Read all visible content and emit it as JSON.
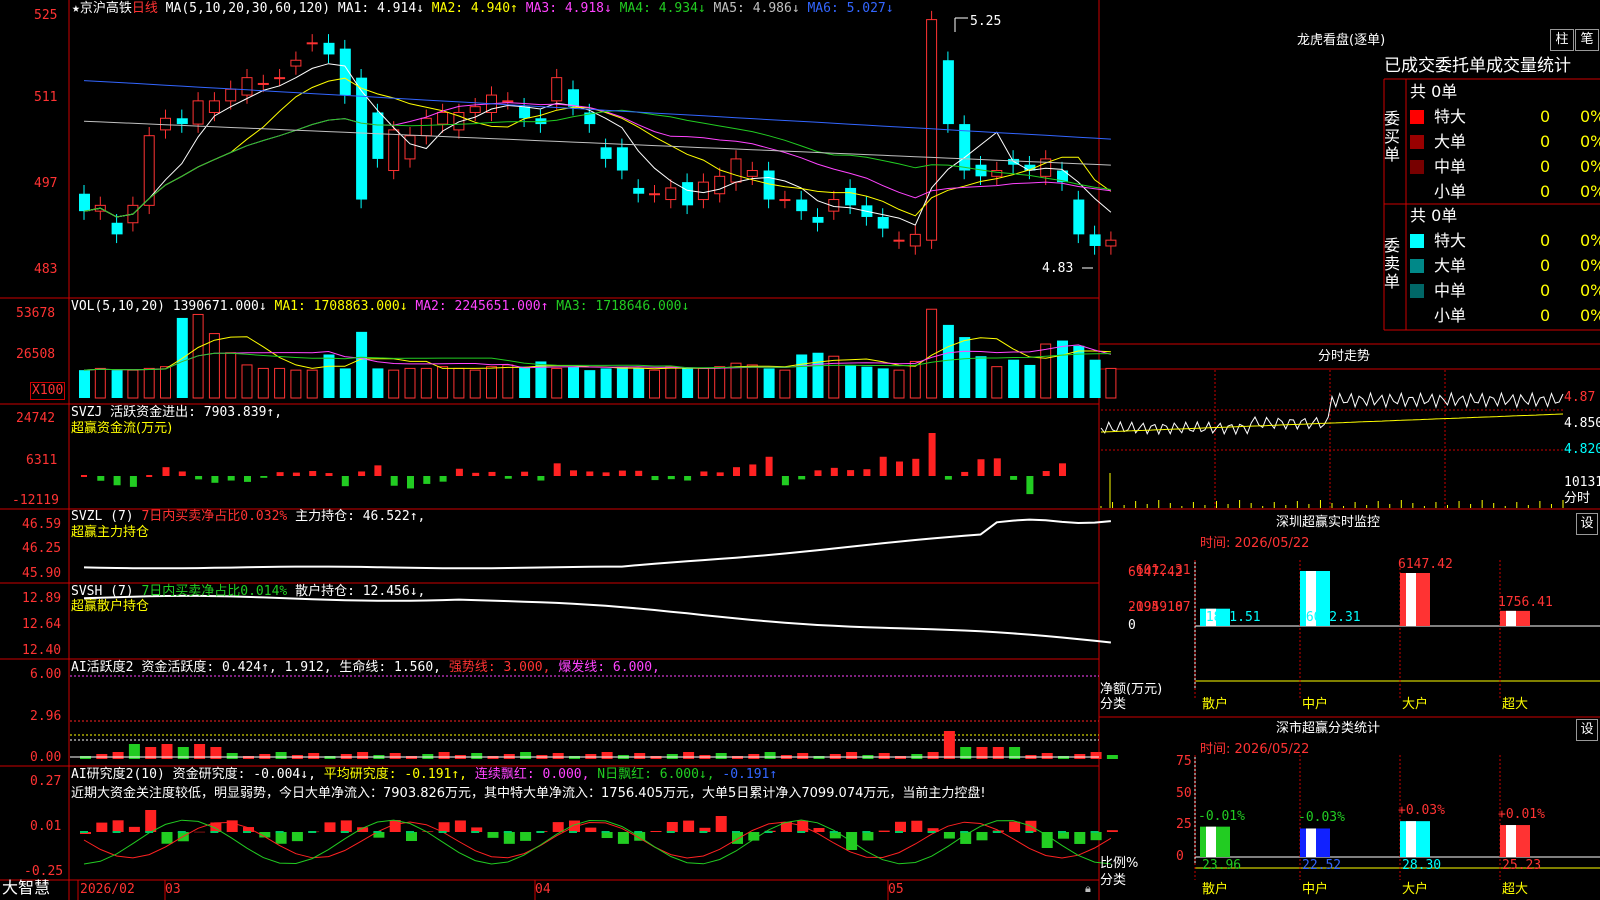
{
  "colors": {
    "up": "#ff3333",
    "down": "#00ffff",
    "bg": "#000000",
    "border": "#cc0000",
    "ma1": "#ffffff",
    "ma2": "#ffff00",
    "ma3": "#ff44ff",
    "ma4": "#22cc22",
    "ma5": "#c0c0c0",
    "ma6": "#3366ff"
  },
  "main": {
    "title": "★京沪高铁",
    "period": "日线",
    "ma_params": "MA(5,10,20,30,60,120)",
    "ma": [
      {
        "label": "MA1:",
        "value": "4.914",
        "arrow": "↓",
        "color": "#ffffff"
      },
      {
        "label": "MA2:",
        "value": "4.940",
        "arrow": "↑",
        "color": "#ffff00"
      },
      {
        "label": "MA3:",
        "value": "4.918",
        "arrow": "↓",
        "color": "#ff44ff"
      },
      {
        "label": "MA4:",
        "value": "4.934",
        "arrow": "↓",
        "color": "#22cc22"
      },
      {
        "label": "MA5:",
        "value": "4.986",
        "arrow": "↓",
        "color": "#c0c0c0"
      },
      {
        "label": "MA6:",
        "value": "5.027",
        "arrow": "↓",
        "color": "#3366ff"
      }
    ],
    "y_ticks": [
      "525",
      "511",
      "497",
      "483"
    ],
    "high_label": "5.25",
    "low_label": "4.83"
  },
  "vol": {
    "title": "VOL(5,10,20)",
    "value": "1390671.000↓",
    "ma1": "MA1: 1708863.000↓",
    "ma2": "MA2: 2245651.000↑",
    "ma3": "MA3: 1718646.000↓",
    "y_ticks": [
      "53678",
      "26508"
    ],
    "unit": "X100"
  },
  "svzj": {
    "title": "SVZJ",
    "text": "活跃资金进出: 7903.839↑,",
    "sub": "超赢资金流(万元)",
    "y_ticks": [
      "24742",
      "6311",
      "-12119"
    ]
  },
  "svzl": {
    "title": "SVZL (7)",
    "pct": "7日内买卖净占比0.032%",
    "text": "主力持仓: 46.522↑,",
    "sub": "超赢主力持仓",
    "y_ticks": [
      "46.59",
      "46.25",
      "45.90"
    ]
  },
  "svsh": {
    "title": "SVSH (7)",
    "pct": "7日内买卖净占比0.014%",
    "text": "散户持仓: 12.456↓,",
    "sub": "超赢散户持仓",
    "y_ticks": [
      "12.89",
      "12.64",
      "12.40"
    ]
  },
  "ai_active": {
    "title": "AI活跃度2",
    "text": "资金活跃度: 0.424↑, 1.912, 生命线: 1.560,",
    "strong": "强势线: 3.000,",
    "burst": "爆发线: 6.000,",
    "y_ticks": [
      "6.00",
      "2.96",
      "0.00"
    ]
  },
  "ai_research": {
    "title": "AI研究度2(10)",
    "r1": "资金研究度: -0.004↓,",
    "r2": "平均研究度: -0.191↑,",
    "r3": "连续飘红: 0.000,",
    "r4": "N日飘红: 6.000↓,",
    "r5": "-0.191↑",
    "comment": "近期大资金关注度较低，明显弱势，今日大单净流入：7903.826万元，其中特大单净流入：1756.405万元，大单5日累计净入7099.074万元，当前主力控盘!",
    "y_ticks": [
      "0.27",
      "0.01",
      "-0.25"
    ]
  },
  "xaxis": {
    "brand": "大智慧",
    "labels": [
      "2026/02",
      "03",
      "04",
      "05"
    ]
  },
  "right": {
    "lhkp_title": "龙虎看盘(逐单)",
    "btn_zhu": "柱",
    "btn_bi": "笔",
    "stats_title": "已成交委托单成交量统计",
    "buy": {
      "side_label": "委买单",
      "total": "共 0单",
      "rows": [
        {
          "label": "特大",
          "v": "0",
          "p": "0%",
          "color": "#ff0000"
        },
        {
          "label": "大单",
          "v": "0",
          "p": "0%",
          "color": "#990000"
        },
        {
          "label": "中单",
          "v": "0",
          "p": "0%",
          "color": "#770000"
        },
        {
          "label": "小单",
          "v": "0",
          "p": "0%",
          "color": "#000000"
        }
      ]
    },
    "sell": {
      "side_label": "委卖单",
      "total": "共 0单",
      "rows": [
        {
          "label": "特大",
          "v": "0",
          "p": "0%",
          "color": "#00ffff"
        },
        {
          "label": "大单",
          "v": "0",
          "p": "0%",
          "color": "#008888"
        },
        {
          "label": "中单",
          "v": "0",
          "p": "0%",
          "color": "#006666"
        },
        {
          "label": "小单",
          "v": "0",
          "p": "0%",
          "color": "#000000"
        }
      ]
    },
    "intraday_title": "分时走势",
    "intraday_ticks": [
      "4.87",
      "4.850",
      "4.820",
      "10131",
      "分时"
    ],
    "sz_monitor": {
      "title": "深圳超赢实时监控",
      "settings": "设",
      "time": "时间: 2026/05/22",
      "y_ticks": [
        "6147.42",
        "2094.18",
        "0",
        "-1959.07",
        "-6012.31"
      ],
      "ylabel": "净额(万元)",
      "xcat": "分类",
      "cats": [
        "散户",
        "中户",
        "大户",
        "超大"
      ],
      "values": [
        -1891.51,
        -6012.31,
        6147.42,
        1756.41
      ],
      "value_labels": [
        "-1891.51",
        "-6012.31",
        "6147.42",
        "1756.41"
      ]
    },
    "sz_class": {
      "title": "深市超赢分类统计",
      "settings": "设",
      "time": "时间: 2026/05/22",
      "y_ticks": [
        "75",
        "50",
        "25",
        "0"
      ],
      "ylabel": "比例%",
      "xcat": "分类",
      "cats": [
        "散户",
        "中户",
        "大户",
        "超大"
      ],
      "values": [
        23.96,
        22.52,
        28.3,
        25.23
      ],
      "value_labels": [
        "23.96",
        "22.52",
        "28.30",
        "25.23"
      ],
      "changes": [
        "-0.01%",
        "-0.03%",
        "+0.03%",
        "+0.01%"
      ]
    }
  },
  "chart_data": [
    {
      "type": "candlestick",
      "title": "京沪高铁 日线",
      "ylim": [
        4.8,
        5.26
      ],
      "open": [
        4.94,
        4.91,
        4.89,
        4.89,
        4.92,
        5.05,
        5.07,
        5.06,
        5.08,
        5.1,
        5.11,
        5.13,
        5.14,
        5.16,
        5.2,
        5.2,
        5.19,
        5.14,
        5.08,
        4.98,
        5.0,
        5.04,
        5.06,
        5.05,
        5.08,
        5.08,
        5.1,
        5.09,
        5.07,
        5.1,
        5.12,
        5.08,
        5.02,
        5.02,
        4.95,
        4.94,
        4.93,
        4.96,
        4.93,
        4.94,
        4.96,
        4.97,
        4.98,
        4.93,
        4.93,
        4.9,
        4.91,
        4.95,
        4.92,
        4.9,
        4.86,
        4.85,
        4.86,
        5.17,
        5.06,
        4.99,
        4.97,
        5.0,
        4.99,
        4.97,
        4.98,
        4.93,
        4.87,
        4.85
      ],
      "close": [
        4.91,
        4.92,
        4.87,
        4.92,
        5.04,
        5.07,
        5.06,
        5.1,
        5.1,
        5.12,
        5.14,
        5.13,
        5.14,
        5.17,
        5.2,
        5.18,
        5.11,
        4.93,
        5.0,
        5.05,
        5.04,
        5.07,
        5.08,
        5.08,
        5.09,
        5.11,
        5.1,
        5.07,
        5.06,
        5.14,
        5.09,
        5.06,
        5.0,
        4.98,
        4.94,
        4.94,
        4.95,
        4.92,
        4.96,
        4.97,
        5.0,
        4.98,
        4.93,
        4.93,
        4.91,
        4.89,
        4.93,
        4.92,
        4.9,
        4.88,
        4.86,
        4.87,
        5.24,
        5.06,
        4.98,
        4.97,
        4.98,
        4.99,
        4.98,
        5.0,
        4.96,
        4.87,
        4.85,
        4.86
      ]
    },
    {
      "type": "bar",
      "title": "VOL(5,10,20)",
      "values": [
        1.6,
        1.7,
        1.6,
        1.6,
        1.7,
        1.8,
        4.6,
        4.8,
        3.7,
        2.6,
        1.9,
        1.7,
        1.7,
        1.6,
        1.6,
        2.5,
        1.7,
        3.8,
        1.7,
        1.6,
        1.7,
        1.7,
        1.8,
        1.7,
        1.6,
        1.8,
        1.9,
        1.8,
        2.1,
        1.7,
        1.8,
        1.6,
        1.7,
        1.8,
        1.7,
        1.6,
        1.8,
        1.7,
        1.7,
        1.8,
        2.0,
        1.9,
        1.7,
        1.6,
        2.5,
        2.6,
        2.4,
        1.9,
        1.8,
        1.7,
        1.6,
        2.1,
        5.1,
        4.2,
        3.5,
        2.4,
        1.8,
        2.2,
        1.9,
        3.1,
        3.3,
        3.0,
        2.2,
        1.7
      ]
    },
    {
      "type": "bar",
      "title": "超赢资金流(万元)",
      "ylim": [
        -12119,
        24742
      ],
      "values": [
        0,
        -2100,
        -4100,
        -4800,
        0,
        3900,
        2000,
        -1500,
        -3000,
        -2000,
        -2600,
        -800,
        1700,
        1500,
        2200,
        1300,
        -4500,
        2000,
        4700,
        -4300,
        -5500,
        -3500,
        -2500,
        3200,
        1400,
        1800,
        -1200,
        1900,
        -2000,
        5600,
        2500,
        2000,
        1600,
        2400,
        2300,
        -1800,
        -1400,
        -2000,
        2000,
        1600,
        3900,
        5100,
        8500,
        -4100,
        -1500,
        2500,
        3600,
        2600,
        3000,
        8500,
        6400,
        7600,
        19000,
        -1600,
        1800,
        7400,
        7800,
        -1700,
        -8000,
        2200,
        5600
      ]
    },
    {
      "type": "line",
      "title": "超赢主力持仓",
      "ylim": [
        45.9,
        46.59
      ]
    },
    {
      "type": "line",
      "title": "超赢散户持仓",
      "ylim": [
        12.4,
        12.89
      ]
    },
    {
      "type": "bar",
      "title": "AI活跃度2",
      "ylim": [
        0,
        6.0
      ]
    },
    {
      "type": "bar",
      "title": "AI研究度2(10)",
      "ylim": [
        -0.25,
        0.27
      ]
    }
  ]
}
